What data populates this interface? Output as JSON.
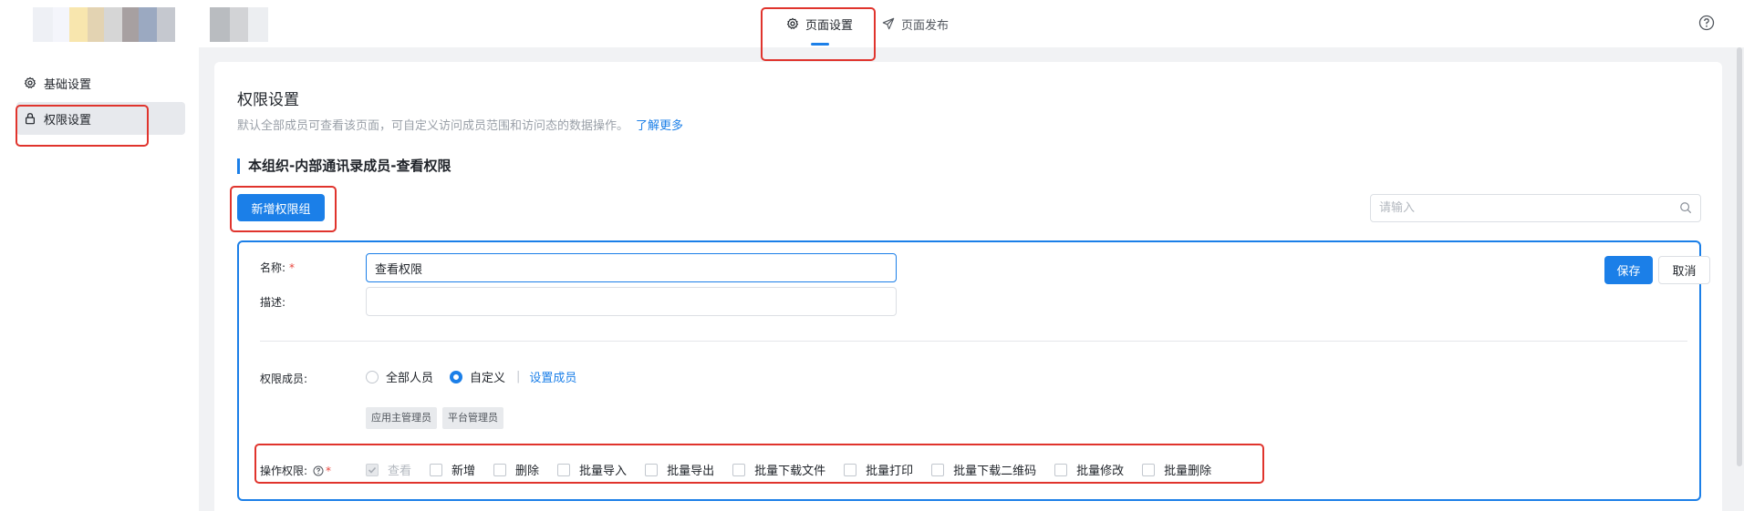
{
  "header": {
    "logo_colors": [
      "#eef0f5",
      "#f4f5fb",
      "#f8e6ae",
      "#e3d3b2",
      "#d6d6d6",
      "#a7a0a1",
      "#9ba9c1",
      "#c5c8cf",
      "#b9bcc0",
      "#d2d3d6"
    ],
    "tabs": [
      {
        "label": "页面设置",
        "icon": "gear-icon",
        "active": true
      },
      {
        "label": "页面发布",
        "icon": "send-icon",
        "active": false
      }
    ],
    "help_icon": "help-circle-icon"
  },
  "sidebar": {
    "items": [
      {
        "label": "基础设置",
        "icon": "gear-icon",
        "active": false
      },
      {
        "label": "权限设置",
        "icon": "lock-icon",
        "active": true
      }
    ]
  },
  "main": {
    "title": "权限设置",
    "description": "默认全部成员可查看该页面，可自定义访问成员范围和访问态的数据操作。",
    "learn_more": "了解更多",
    "section_title": "本组织-内部通讯录成员-查看权限",
    "add_group_label": "新增权限组",
    "search": {
      "placeholder": "请输入"
    },
    "form": {
      "name_label": "名称:",
      "name_value": "查看权限",
      "desc_label": "描述:",
      "desc_value": "",
      "save_label": "保存",
      "cancel_label": "取消",
      "members_label": "权限成员:",
      "member_options": [
        {
          "label": "全部人员",
          "checked": false
        },
        {
          "label": "自定义",
          "checked": true
        }
      ],
      "set_members_label": "设置成员",
      "member_tags": [
        "应用主管理员",
        "平台管理员"
      ],
      "ops_label": "操作权限:",
      "ops": [
        {
          "label": "查看",
          "checked": true,
          "disabled": true
        },
        {
          "label": "新增",
          "checked": false,
          "disabled": false
        },
        {
          "label": "删除",
          "checked": false,
          "disabled": false
        },
        {
          "label": "批量导入",
          "checked": false,
          "disabled": false
        },
        {
          "label": "批量导出",
          "checked": false,
          "disabled": false
        },
        {
          "label": "批量下载文件",
          "checked": false,
          "disabled": false
        },
        {
          "label": "批量打印",
          "checked": false,
          "disabled": false
        },
        {
          "label": "批量下载二维码",
          "checked": false,
          "disabled": false
        },
        {
          "label": "批量修改",
          "checked": false,
          "disabled": false
        },
        {
          "label": "批量删除",
          "checked": false,
          "disabled": false
        }
      ]
    }
  },
  "colors": {
    "accent": "#1b7fe8",
    "highlight": "#e0342d",
    "required": "#e8453c"
  }
}
